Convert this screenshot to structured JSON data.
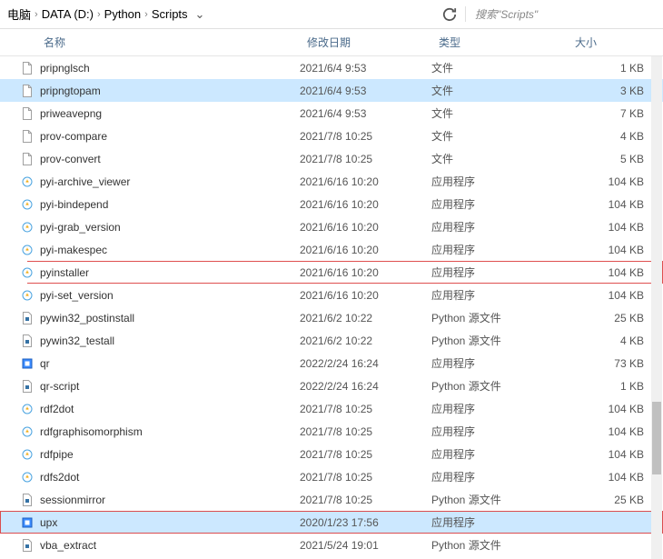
{
  "breadcrumb": [
    "电脑",
    "DATA (D:)",
    "Python",
    "Scripts"
  ],
  "search_placeholder": "搜索\"Scripts\"",
  "cols": {
    "name": "名称",
    "date": "修改日期",
    "type": "类型",
    "size": "大小"
  },
  "icons": {
    "file": "file",
    "app": "app",
    "py": "py",
    "box": "box"
  },
  "files": [
    {
      "name": "pripnglsch",
      "date": "2021/6/4 9:53",
      "type": "文件",
      "size": "1 KB",
      "icon": "file"
    },
    {
      "name": "pripngtopam",
      "date": "2021/6/4 9:53",
      "type": "文件",
      "size": "3 KB",
      "icon": "file",
      "selected": true
    },
    {
      "name": "priweavepng",
      "date": "2021/6/4 9:53",
      "type": "文件",
      "size": "7 KB",
      "icon": "file"
    },
    {
      "name": "prov-compare",
      "date": "2021/7/8 10:25",
      "type": "文件",
      "size": "4 KB",
      "icon": "file"
    },
    {
      "name": "prov-convert",
      "date": "2021/7/8 10:25",
      "type": "文件",
      "size": "5 KB",
      "icon": "file"
    },
    {
      "name": "pyi-archive_viewer",
      "date": "2021/6/16 10:20",
      "type": "应用程序",
      "size": "104 KB",
      "icon": "app"
    },
    {
      "name": "pyi-bindepend",
      "date": "2021/6/16 10:20",
      "type": "应用程序",
      "size": "104 KB",
      "icon": "app"
    },
    {
      "name": "pyi-grab_version",
      "date": "2021/6/16 10:20",
      "type": "应用程序",
      "size": "104 KB",
      "icon": "app"
    },
    {
      "name": "pyi-makespec",
      "date": "2021/6/16 10:20",
      "type": "应用程序",
      "size": "104 KB",
      "icon": "app"
    },
    {
      "name": "pyinstaller",
      "date": "2021/6/16 10:20",
      "type": "应用程序",
      "size": "104 KB",
      "icon": "app",
      "hl": "1"
    },
    {
      "name": "pyi-set_version",
      "date": "2021/6/16 10:20",
      "type": "应用程序",
      "size": "104 KB",
      "icon": "app"
    },
    {
      "name": "pywin32_postinstall",
      "date": "2021/6/2 10:22",
      "type": "Python 源文件",
      "size": "25 KB",
      "icon": "py"
    },
    {
      "name": "pywin32_testall",
      "date": "2021/6/2 10:22",
      "type": "Python 源文件",
      "size": "4 KB",
      "icon": "py"
    },
    {
      "name": "qr",
      "date": "2022/2/24 16:24",
      "type": "应用程序",
      "size": "73 KB",
      "icon": "box"
    },
    {
      "name": "qr-script",
      "date": "2022/2/24 16:24",
      "type": "Python 源文件",
      "size": "1 KB",
      "icon": "py"
    },
    {
      "name": "rdf2dot",
      "date": "2021/7/8 10:25",
      "type": "应用程序",
      "size": "104 KB",
      "icon": "app"
    },
    {
      "name": "rdfgraphisomorphism",
      "date": "2021/7/8 10:25",
      "type": "应用程序",
      "size": "104 KB",
      "icon": "app"
    },
    {
      "name": "rdfpipe",
      "date": "2021/7/8 10:25",
      "type": "应用程序",
      "size": "104 KB",
      "icon": "app"
    },
    {
      "name": "rdfs2dot",
      "date": "2021/7/8 10:25",
      "type": "应用程序",
      "size": "104 KB",
      "icon": "app"
    },
    {
      "name": "sessionmirror",
      "date": "2021/7/8 10:25",
      "type": "Python 源文件",
      "size": "25 KB",
      "icon": "py"
    },
    {
      "name": "upx",
      "date": "2020/1/23 17:56",
      "type": "应用程序",
      "size": "",
      "icon": "box",
      "selected": true,
      "hl": "2"
    },
    {
      "name": "vba_extract",
      "date": "2021/5/24 19:01",
      "type": "Python 源文件",
      "size": "",
      "icon": "py"
    }
  ]
}
